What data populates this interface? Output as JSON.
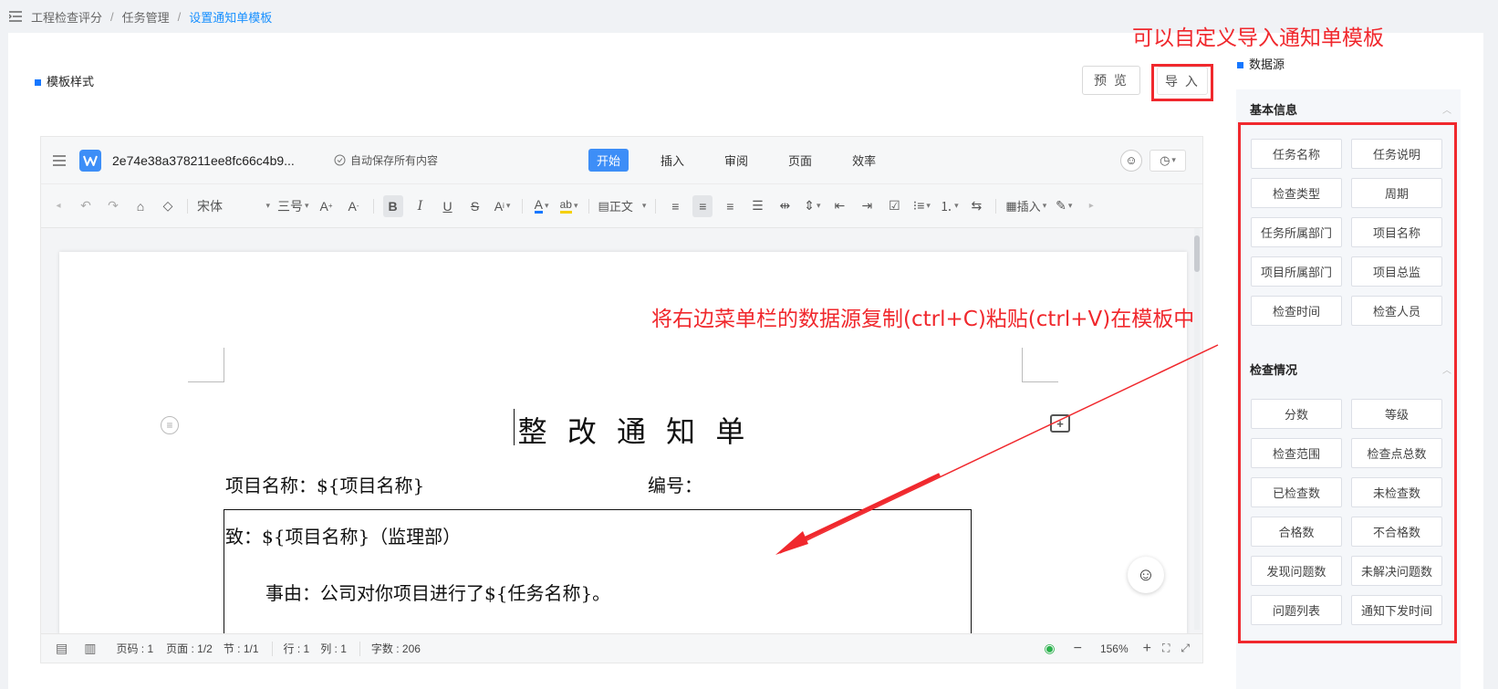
{
  "breadcrumb": {
    "items": [
      "工程检查评分",
      "任务管理",
      "设置通知单模板"
    ],
    "sep": "/"
  },
  "template_section": {
    "title": "模板样式",
    "preview_button": "预 览",
    "import_button": "导 入"
  },
  "annotations": {
    "top": "可以自定义导入通知单模板",
    "middle": "将右边菜单栏的数据源复制(ctrl+C)粘贴(ctrl+V)在模板中"
  },
  "editor": {
    "filename": "2e74e38a378211ee8fc66c4b9...",
    "autosave": "自动保存所有内容",
    "tabs": [
      {
        "label": "开始",
        "active": true
      },
      {
        "label": "插入",
        "active": false
      },
      {
        "label": "审阅",
        "active": false
      },
      {
        "label": "页面",
        "active": false
      },
      {
        "label": "效率",
        "active": false
      }
    ],
    "toolbar": {
      "font_name": "宋体",
      "font_size": "三号",
      "style": "正文",
      "insert": "插入"
    },
    "status": {
      "page": "页码 : 1",
      "pages": "页面 : 1/2",
      "section": "节 : 1/1",
      "row": "行 : 1",
      "col": "列 : 1",
      "words": "字数 : 206",
      "zoom": "156%"
    }
  },
  "document": {
    "title": "整 改 通 知 单",
    "project_label": "项目名称：${项目名称}",
    "number_label": "编号：",
    "to_line": "致：${项目名称}（监理部）",
    "reason_line": "事由：公司对你项目进行了${任务名称}。"
  },
  "datasource": {
    "title": "数据源",
    "groups": [
      {
        "title": "基本信息",
        "items": [
          "任务名称",
          "任务说明",
          "检查类型",
          "周期",
          "任务所属部门",
          "项目名称",
          "项目所属部门",
          "项目总监",
          "检查时间",
          "检查人员"
        ]
      },
      {
        "title": "检查情况",
        "items": [
          "分数",
          "等级",
          "检查范围",
          "检查点总数",
          "已检查数",
          "未检查数",
          "合格数",
          "不合格数",
          "发现问题数",
          "未解决问题数",
          "问题列表",
          "通知下发时间"
        ]
      }
    ]
  },
  "colors": {
    "accent": "#1677ff",
    "annotation_red": "#f0282d",
    "wps_blue": "#3d8ef7"
  }
}
